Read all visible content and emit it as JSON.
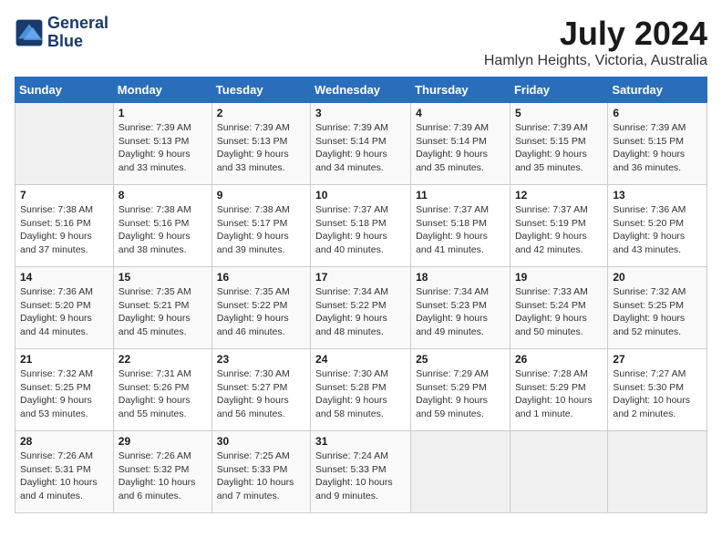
{
  "logo": {
    "name_line1": "General",
    "name_line2": "Blue"
  },
  "title": "July 2024",
  "subtitle": "Hamlyn Heights, Victoria, Australia",
  "days_header": [
    "Sunday",
    "Monday",
    "Tuesday",
    "Wednesday",
    "Thursday",
    "Friday",
    "Saturday"
  ],
  "weeks": [
    [
      {
        "day": "",
        "empty": true
      },
      {
        "day": "1",
        "sunrise": "Sunrise: 7:39 AM",
        "sunset": "Sunset: 5:13 PM",
        "daylight": "Daylight: 9 hours and 33 minutes."
      },
      {
        "day": "2",
        "sunrise": "Sunrise: 7:39 AM",
        "sunset": "Sunset: 5:13 PM",
        "daylight": "Daylight: 9 hours and 33 minutes."
      },
      {
        "day": "3",
        "sunrise": "Sunrise: 7:39 AM",
        "sunset": "Sunset: 5:14 PM",
        "daylight": "Daylight: 9 hours and 34 minutes."
      },
      {
        "day": "4",
        "sunrise": "Sunrise: 7:39 AM",
        "sunset": "Sunset: 5:14 PM",
        "daylight": "Daylight: 9 hours and 35 minutes."
      },
      {
        "day": "5",
        "sunrise": "Sunrise: 7:39 AM",
        "sunset": "Sunset: 5:15 PM",
        "daylight": "Daylight: 9 hours and 35 minutes."
      },
      {
        "day": "6",
        "sunrise": "Sunrise: 7:39 AM",
        "sunset": "Sunset: 5:15 PM",
        "daylight": "Daylight: 9 hours and 36 minutes."
      }
    ],
    [
      {
        "day": "7",
        "sunrise": "Sunrise: 7:38 AM",
        "sunset": "Sunset: 5:16 PM",
        "daylight": "Daylight: 9 hours and 37 minutes."
      },
      {
        "day": "8",
        "sunrise": "Sunrise: 7:38 AM",
        "sunset": "Sunset: 5:16 PM",
        "daylight": "Daylight: 9 hours and 38 minutes."
      },
      {
        "day": "9",
        "sunrise": "Sunrise: 7:38 AM",
        "sunset": "Sunset: 5:17 PM",
        "daylight": "Daylight: 9 hours and 39 minutes."
      },
      {
        "day": "10",
        "sunrise": "Sunrise: 7:37 AM",
        "sunset": "Sunset: 5:18 PM",
        "daylight": "Daylight: 9 hours and 40 minutes."
      },
      {
        "day": "11",
        "sunrise": "Sunrise: 7:37 AM",
        "sunset": "Sunset: 5:18 PM",
        "daylight": "Daylight: 9 hours and 41 minutes."
      },
      {
        "day": "12",
        "sunrise": "Sunrise: 7:37 AM",
        "sunset": "Sunset: 5:19 PM",
        "daylight": "Daylight: 9 hours and 42 minutes."
      },
      {
        "day": "13",
        "sunrise": "Sunrise: 7:36 AM",
        "sunset": "Sunset: 5:20 PM",
        "daylight": "Daylight: 9 hours and 43 minutes."
      }
    ],
    [
      {
        "day": "14",
        "sunrise": "Sunrise: 7:36 AM",
        "sunset": "Sunset: 5:20 PM",
        "daylight": "Daylight: 9 hours and 44 minutes."
      },
      {
        "day": "15",
        "sunrise": "Sunrise: 7:35 AM",
        "sunset": "Sunset: 5:21 PM",
        "daylight": "Daylight: 9 hours and 45 minutes."
      },
      {
        "day": "16",
        "sunrise": "Sunrise: 7:35 AM",
        "sunset": "Sunset: 5:22 PM",
        "daylight": "Daylight: 9 hours and 46 minutes."
      },
      {
        "day": "17",
        "sunrise": "Sunrise: 7:34 AM",
        "sunset": "Sunset: 5:22 PM",
        "daylight": "Daylight: 9 hours and 48 minutes."
      },
      {
        "day": "18",
        "sunrise": "Sunrise: 7:34 AM",
        "sunset": "Sunset: 5:23 PM",
        "daylight": "Daylight: 9 hours and 49 minutes."
      },
      {
        "day": "19",
        "sunrise": "Sunrise: 7:33 AM",
        "sunset": "Sunset: 5:24 PM",
        "daylight": "Daylight: 9 hours and 50 minutes."
      },
      {
        "day": "20",
        "sunrise": "Sunrise: 7:32 AM",
        "sunset": "Sunset: 5:25 PM",
        "daylight": "Daylight: 9 hours and 52 minutes."
      }
    ],
    [
      {
        "day": "21",
        "sunrise": "Sunrise: 7:32 AM",
        "sunset": "Sunset: 5:25 PM",
        "daylight": "Daylight: 9 hours and 53 minutes."
      },
      {
        "day": "22",
        "sunrise": "Sunrise: 7:31 AM",
        "sunset": "Sunset: 5:26 PM",
        "daylight": "Daylight: 9 hours and 55 minutes."
      },
      {
        "day": "23",
        "sunrise": "Sunrise: 7:30 AM",
        "sunset": "Sunset: 5:27 PM",
        "daylight": "Daylight: 9 hours and 56 minutes."
      },
      {
        "day": "24",
        "sunrise": "Sunrise: 7:30 AM",
        "sunset": "Sunset: 5:28 PM",
        "daylight": "Daylight: 9 hours and 58 minutes."
      },
      {
        "day": "25",
        "sunrise": "Sunrise: 7:29 AM",
        "sunset": "Sunset: 5:29 PM",
        "daylight": "Daylight: 9 hours and 59 minutes."
      },
      {
        "day": "26",
        "sunrise": "Sunrise: 7:28 AM",
        "sunset": "Sunset: 5:29 PM",
        "daylight": "Daylight: 10 hours and 1 minute."
      },
      {
        "day": "27",
        "sunrise": "Sunrise: 7:27 AM",
        "sunset": "Sunset: 5:30 PM",
        "daylight": "Daylight: 10 hours and 2 minutes."
      }
    ],
    [
      {
        "day": "28",
        "sunrise": "Sunrise: 7:26 AM",
        "sunset": "Sunset: 5:31 PM",
        "daylight": "Daylight: 10 hours and 4 minutes."
      },
      {
        "day": "29",
        "sunrise": "Sunrise: 7:26 AM",
        "sunset": "Sunset: 5:32 PM",
        "daylight": "Daylight: 10 hours and 6 minutes."
      },
      {
        "day": "30",
        "sunrise": "Sunrise: 7:25 AM",
        "sunset": "Sunset: 5:33 PM",
        "daylight": "Daylight: 10 hours and 7 minutes."
      },
      {
        "day": "31",
        "sunrise": "Sunrise: 7:24 AM",
        "sunset": "Sunset: 5:33 PM",
        "daylight": "Daylight: 10 hours and 9 minutes."
      },
      {
        "day": "",
        "empty": true
      },
      {
        "day": "",
        "empty": true
      },
      {
        "day": "",
        "empty": true
      }
    ]
  ]
}
